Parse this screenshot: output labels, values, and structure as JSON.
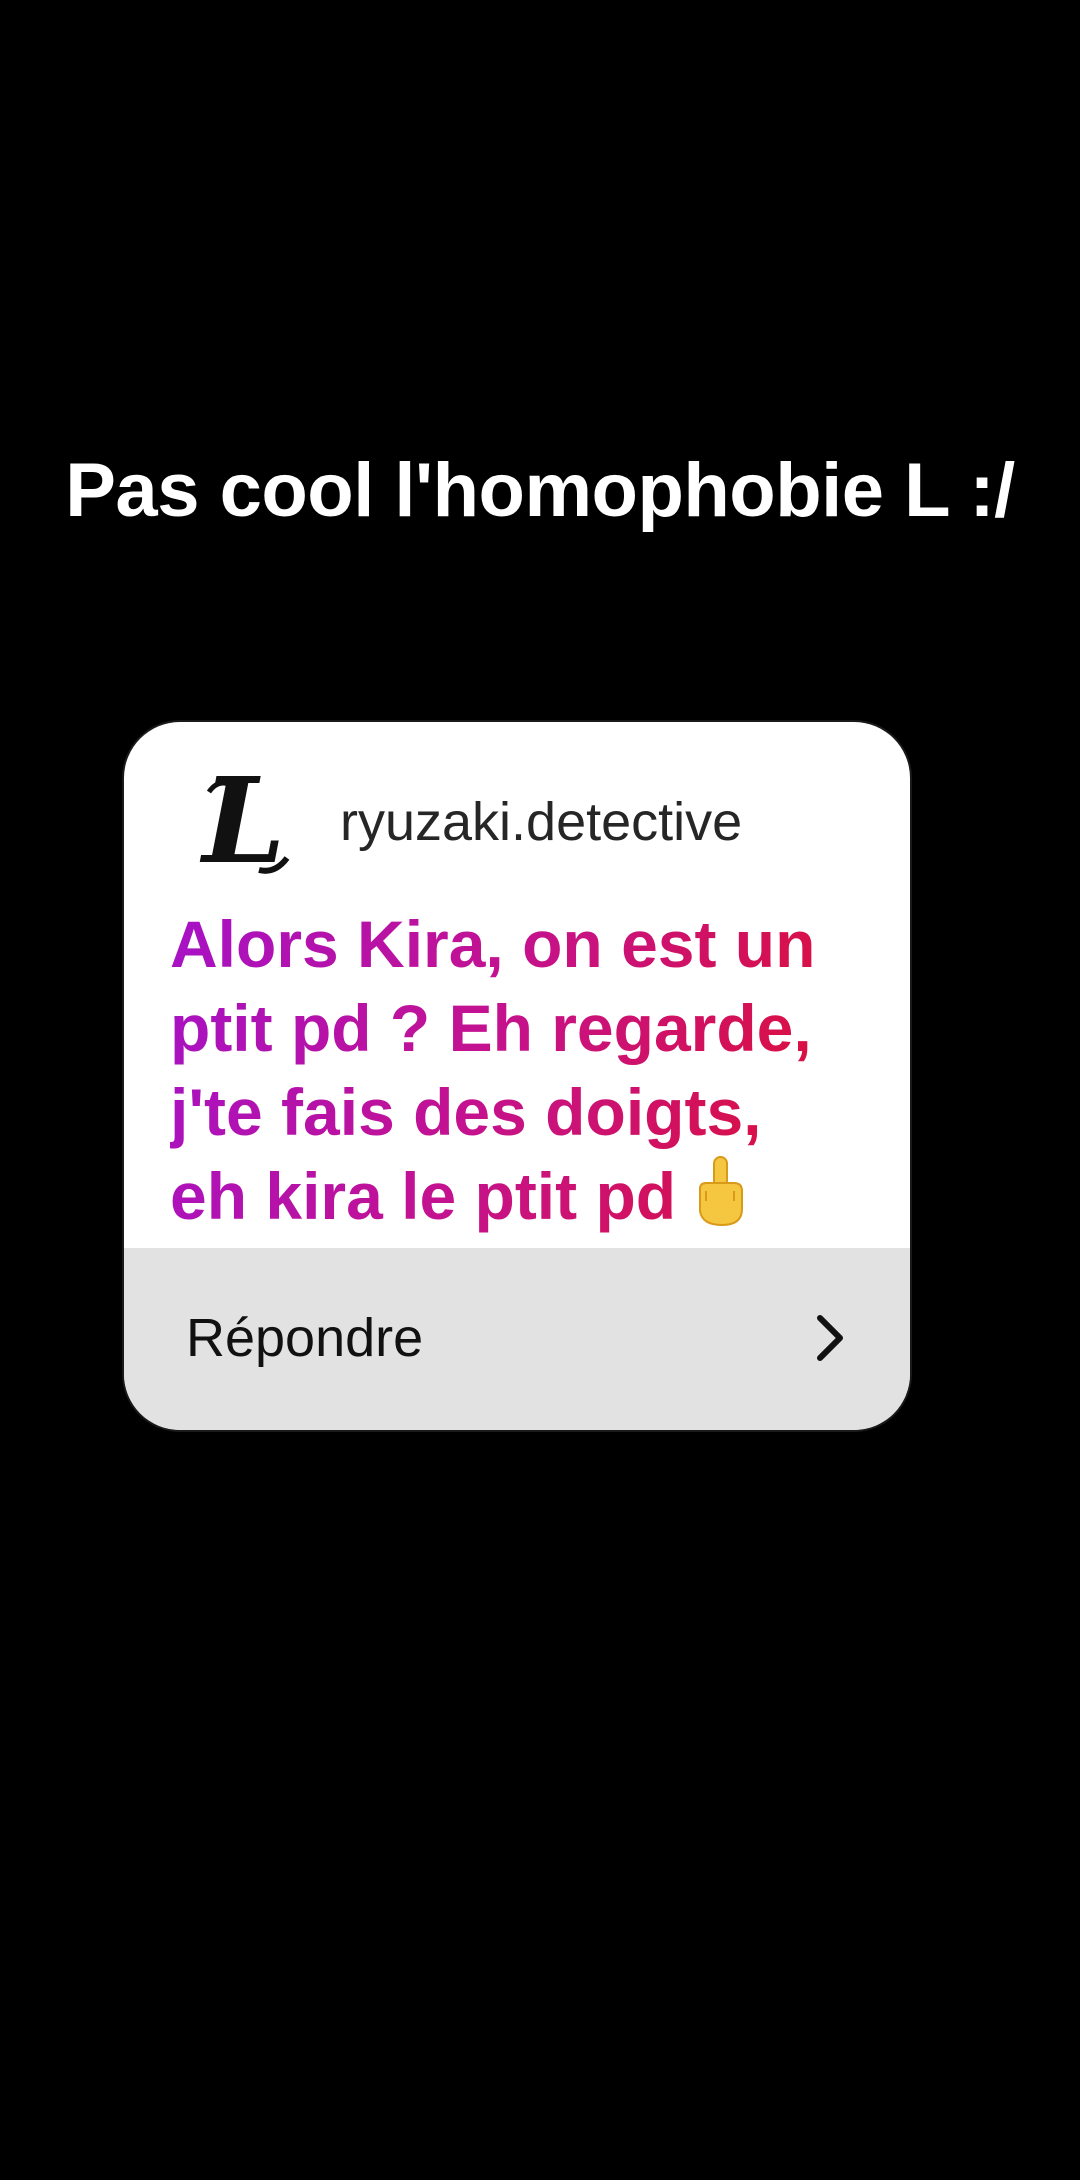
{
  "caption": "Pas cool l'homophobie L :/",
  "card": {
    "avatar_icon": "death-note-L-logo",
    "username": "ryuzaki.detective",
    "message_lines": [
      "Alors Kira, on est un",
      "ptit pd ? Eh regarde,",
      "j'te fais des doigts,",
      "eh kira le ptit pd"
    ],
    "message_emoji": "middle-finger-icon",
    "reply_label": "Répondre",
    "reply_icon": "chevron-right-icon",
    "colors": {
      "gradient_start": "#a612c6",
      "gradient_end": "#e0102a",
      "reply_bar": "#e2e2e2"
    }
  }
}
